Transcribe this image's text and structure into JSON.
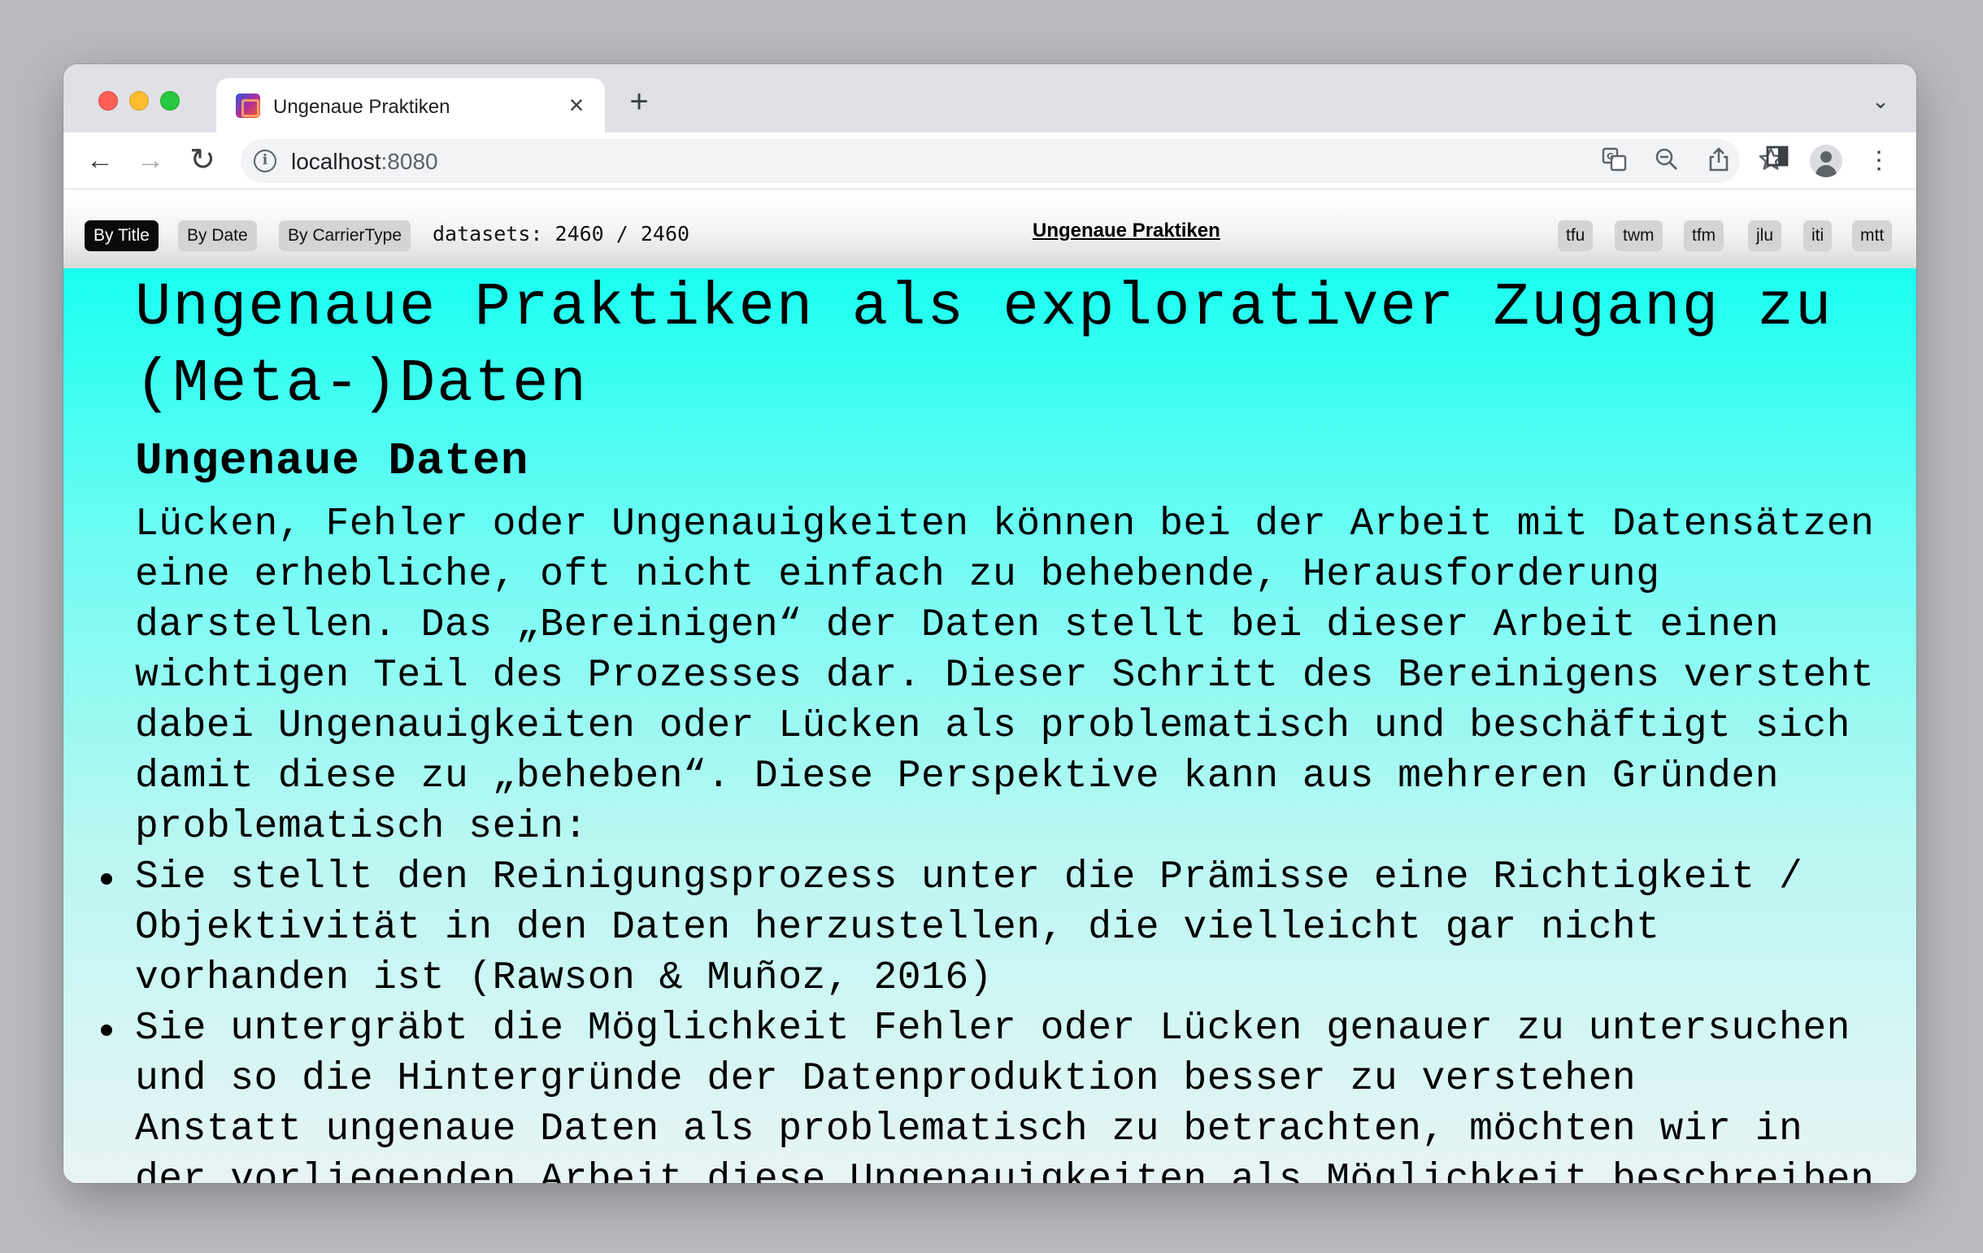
{
  "browser": {
    "tab_title": "Ungenaue Praktiken",
    "tab_close": "×",
    "new_tab": "+",
    "tab_search": "⌄",
    "url_host": "localhost",
    "url_port": ":8080",
    "nav": {
      "back": "←",
      "forward": "→",
      "reload": "↻"
    },
    "menu": "⋮"
  },
  "appbar": {
    "sort_buttons": [
      "By Title",
      "By Date",
      "By CarrierType"
    ],
    "active_sort": "By Title",
    "datasets_label": "datasets: 2460 / 2460",
    "site_title": "Ungenaue Praktiken",
    "tags": [
      "tfu",
      "twm",
      "tfm",
      "jlu",
      "iti",
      "mtt"
    ]
  },
  "article": {
    "title": "Ungenaue Praktiken als explorativer Zugang zu (Meta-)Daten",
    "section_heading": "Ungenaue Daten",
    "intro": "Lücken, Fehler oder Ungenauigkeiten können bei der Arbeit mit Datensätzen eine erhebliche, oft nicht einfach zu behebende, Herausforderung darstellen. Das „Bereinigen“ der Daten stellt bei dieser Arbeit einen wichtigen Teil des Prozesses dar. Dieser Schritt des Bereinigens versteht dabei Ungenauigkeiten oder Lücken als problematisch und beschäftigt sich damit diese zu „beheben“. Diese Perspektive kann aus mehreren Gründen problematisch sein:",
    "bullets": [
      "Sie stellt den Reinigungsprozess unter die Prämisse eine Richtigkeit / Objektivität in den Daten herzustellen, die vielleicht gar nicht vorhanden ist (Rawson & Muñoz, 2016)",
      "Sie untergräbt die Möglichkeit Fehler oder Lücken genauer zu untersuchen und so die Hintergründe der Datenproduktion besser zu verstehen"
    ],
    "closing": "Anstatt ungenaue Daten als problematisch zu betrachten, möchten wir in der vorliegenden Arbeit diese Ungenauigkeiten als Möglichkeit beschreiben"
  },
  "colors": {
    "content_gradient_top": "#18fff0",
    "content_gradient_bottom": "#e8f4f4",
    "active_button": "#0a0a0a"
  }
}
